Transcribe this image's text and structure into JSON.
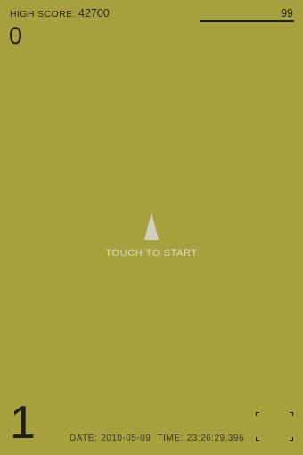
{
  "hud": {
    "high_score_label": "HIGH SCORE:",
    "high_score": "42700",
    "score": "0",
    "meter_value": "99",
    "level": "1"
  },
  "center": {
    "start_message": "TOUCH TO START"
  },
  "footer": {
    "date_label": "DATE:",
    "date": "2010-05-09",
    "time_label": "TIME:",
    "time": "23:26:29.396"
  },
  "colors": {
    "background": "#a6a13e",
    "text_dark": "#1e1e14",
    "ship": "#d0cfc2",
    "start_message": "#dcdac4"
  },
  "icons": {
    "ship": "ship-icon",
    "bracket": "corner-bracket-icon"
  }
}
